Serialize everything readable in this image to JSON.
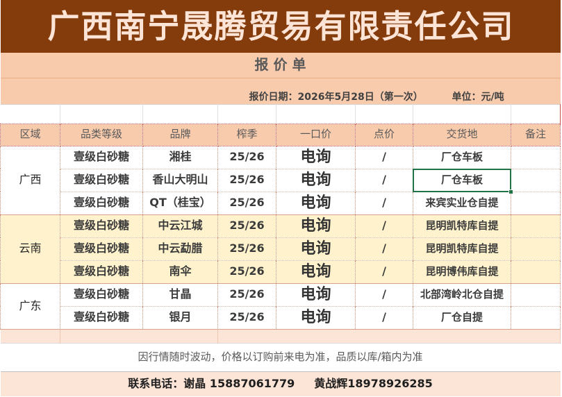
{
  "header": {
    "company_name": "广西南宁晟腾贸易有限责任公司",
    "sheet_title": "报 价 单",
    "quote_date": "报价日期：2026年5月28日（第一次）",
    "unit": "单位：元/吨"
  },
  "table": {
    "columns": [
      "区域",
      "品类等级",
      "品牌",
      "榨季",
      "一口价",
      "点价",
      "交货地",
      "备注"
    ],
    "regions": [
      {
        "name": "广西",
        "rows": [
          {
            "grade": "壹级白砂糖",
            "brand": "湘桂",
            "season": "25/26",
            "price": "电询",
            "basis_price": "/",
            "delivery": "厂仓车板",
            "remark": ""
          },
          {
            "grade": "壹级白砂糖",
            "brand": "香山大明山",
            "season": "25/26",
            "price": "电询",
            "basis_price": "/",
            "delivery": "厂仓车板",
            "remark": ""
          },
          {
            "grade": "壹级白砂糖",
            "brand": "QT（桂宝）",
            "season": "25/26",
            "price": "电询",
            "basis_price": "/",
            "delivery": "来宾实业仓自提",
            "remark": ""
          }
        ]
      },
      {
        "name": "云南",
        "rows": [
          {
            "grade": "壹级白砂糖",
            "brand": "中云江城",
            "season": "25/26",
            "price": "电询",
            "basis_price": "/",
            "delivery": "昆明凯特库自提",
            "remark": ""
          },
          {
            "grade": "壹级白砂糖",
            "brand": "中云勐腊",
            "season": "25/26",
            "price": "电询",
            "basis_price": "/",
            "delivery": "昆明凯特库自提",
            "remark": ""
          },
          {
            "grade": "壹级白砂糖",
            "brand": "南伞",
            "season": "25/26",
            "price": "电询",
            "basis_price": "/",
            "delivery": "昆明博伟库自提",
            "remark": ""
          }
        ]
      },
      {
        "name": "广东",
        "rows": [
          {
            "grade": "壹级白砂糖",
            "brand": "甘晶",
            "season": "25/26",
            "price": "电询",
            "basis_price": "/",
            "delivery": "北部湾岭北仓自提",
            "remark": ""
          },
          {
            "grade": "壹级白砂糖",
            "brand": "银月",
            "season": "25/26",
            "price": "电询",
            "basis_price": "/",
            "delivery": "厂仓自提",
            "remark": ""
          }
        ]
      }
    ]
  },
  "footer": {
    "note": "因行情随时波动，价格以订购前来电为准，品质以库/箱内为准",
    "contact_primary": "联系电话：谢晶 15887061779",
    "contact_secondary": "黄战辉18978926285"
  },
  "colors": {
    "banner": "#843C0C",
    "title_text": "#FCE4D6",
    "band_peach": "#F8CBAD",
    "band_light": "#FCE4D6",
    "yunnan_fill": "#FFF2CC",
    "selection": "#217346"
  }
}
